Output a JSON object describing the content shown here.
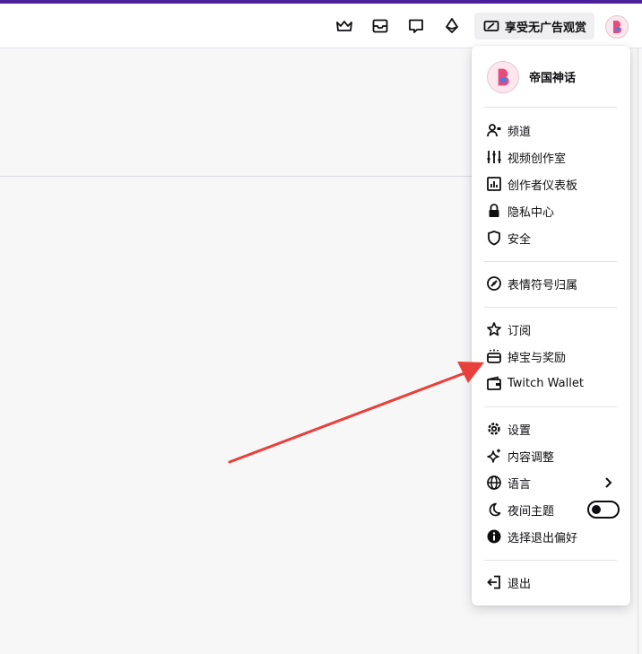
{
  "topbar": {
    "adfree_label": "享受无广告观赏",
    "icons": [
      "crown-icon",
      "inbox-icon",
      "whispers-icon",
      "bits-icon",
      "ad-free-icon",
      "avatar"
    ]
  },
  "menu": {
    "username": "帝国神话",
    "groups": [
      [
        {
          "label": "频道",
          "icon": "channel-icon"
        },
        {
          "label": "视频创作室",
          "icon": "sliders-icon"
        },
        {
          "label": "创作者仪表板",
          "icon": "dashboard-icon"
        },
        {
          "label": "隐私中心",
          "icon": "lock-icon"
        },
        {
          "label": "安全",
          "icon": "shield-icon"
        }
      ],
      [
        {
          "label": "表情符号归属",
          "icon": "emote-icon"
        }
      ],
      [
        {
          "label": "订阅",
          "icon": "star-icon"
        },
        {
          "label": "掉宝与奖励",
          "icon": "drops-icon"
        },
        {
          "label": "Twitch Wallet",
          "icon": "wallet-icon"
        }
      ],
      [
        {
          "label": "设置",
          "icon": "gear-icon"
        },
        {
          "label": "内容调整",
          "icon": "sparkle-icon"
        },
        {
          "label": "语言",
          "icon": "globe-icon"
        },
        {
          "label": "夜间主题",
          "icon": "moon-icon"
        },
        {
          "label": "选择退出偏好",
          "icon": "info-icon"
        }
      ],
      [
        {
          "label": "退出",
          "icon": "logout-icon"
        }
      ]
    ]
  },
  "colors": {
    "stripe": "#4b1f9a",
    "annotation_arrow": "#e8403c",
    "text": "#0e0e10"
  }
}
